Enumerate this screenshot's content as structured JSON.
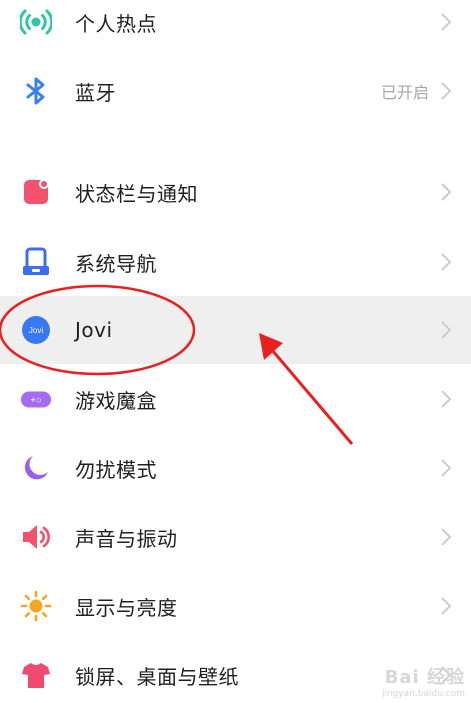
{
  "settings": {
    "items": [
      {
        "label": "个人热点",
        "icon": "hotspot-icon"
      },
      {
        "label": "蓝牙",
        "value": "已开启",
        "icon": "bluetooth-icon"
      },
      {
        "label": "状态栏与通知",
        "icon": "status-bar-icon"
      },
      {
        "label": "系统导航",
        "icon": "navigation-icon"
      },
      {
        "label": "Jovi",
        "icon": "jovi-icon",
        "icon_text": "Jovi"
      },
      {
        "label": "游戏魔盒",
        "icon": "game-box-icon",
        "icon_text": "+○"
      },
      {
        "label": "勿扰模式",
        "icon": "moon-icon"
      },
      {
        "label": "声音与振动",
        "icon": "speaker-icon"
      },
      {
        "label": "显示与亮度",
        "icon": "sun-icon"
      },
      {
        "label": "锁屏、桌面与壁纸",
        "icon": "tshirt-icon"
      }
    ]
  },
  "watermark": {
    "main": "Bai 经验",
    "sub": "jingyan.baidu.com"
  },
  "colors": {
    "hotspot": "#2ec6a6",
    "bluetooth": "#3b7ff5",
    "status_bar": "#f4516c",
    "navigation": "#3b6ef5",
    "jovi": "#3a78f2",
    "game_box": "#a56cf0",
    "moon": "#9a5ef0",
    "speaker": "#f4516c",
    "sun": "#f5a623",
    "tshirt": "#f04a6e",
    "annotation": "#e8201f"
  }
}
